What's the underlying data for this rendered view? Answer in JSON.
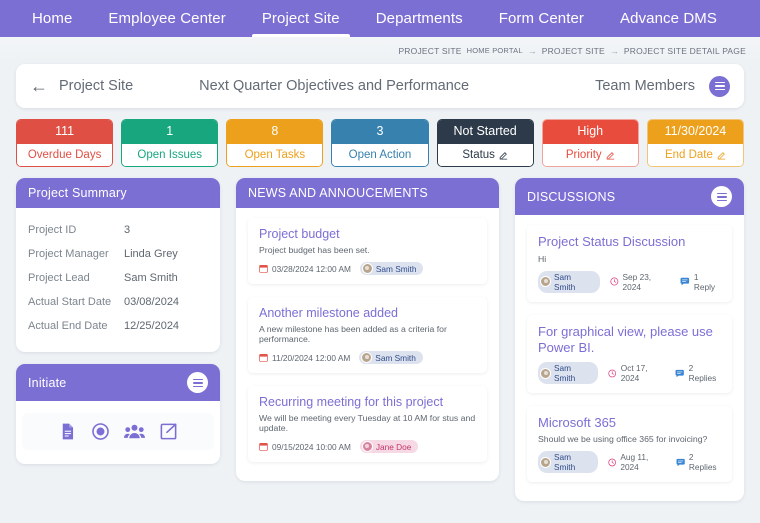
{
  "nav": {
    "items": [
      {
        "label": "Home",
        "active": false
      },
      {
        "label": "Employee Center",
        "active": false
      },
      {
        "label": "Project Site",
        "active": true
      },
      {
        "label": "Departments",
        "active": false
      },
      {
        "label": "Form Center",
        "active": false
      },
      {
        "label": "Advance DMS",
        "active": false
      }
    ]
  },
  "breadcrumb": {
    "label": "PROJECT SITE",
    "items": [
      "HOME PORTAL",
      "PROJECT SITE",
      "PROJECT SITE DETAIL PAGE"
    ],
    "separator": "→"
  },
  "titlebar": {
    "back_icon": "arrow-left-icon",
    "back_label": "Project Site",
    "page_title": "Next Quarter Objectives and Performance",
    "team_members_label": "Team Members",
    "menu_icon": "hamburger-icon"
  },
  "kpis": [
    {
      "value": "111",
      "label": "Overdue Days",
      "color": "#e04f44",
      "editable": false
    },
    {
      "value": "1",
      "label": "Open Issues",
      "color": "#18a67f",
      "editable": false
    },
    {
      "value": "8",
      "label": "Open Tasks",
      "color": "#eda01b",
      "editable": false
    },
    {
      "value": "3",
      "label": "Open Action",
      "color": "#3681ad",
      "editable": false
    },
    {
      "value": "Not Started",
      "label": "Status",
      "color": "#2c3a49",
      "editable": true
    },
    {
      "value": "High",
      "label": "Priority",
      "color": "#e84c3d",
      "editable": true
    },
    {
      "value": "11/30/2024",
      "label": "End Date",
      "color": "#eda01b",
      "editable": true
    }
  ],
  "summary": {
    "title": "Project Summary",
    "rows": [
      {
        "key": "Project ID",
        "value": "3"
      },
      {
        "key": "Project Manager",
        "value": "Linda Grey"
      },
      {
        "key": "Project Lead",
        "value": "Sam Smith"
      },
      {
        "key": "Actual Start Date",
        "value": "03/08/2024"
      },
      {
        "key": "Actual End Date",
        "value": "12/25/2024"
      }
    ]
  },
  "initiate": {
    "title": "Initiate",
    "menu_icon": "hamburger-icon",
    "actions": [
      {
        "icon": "document-icon"
      },
      {
        "icon": "record-circle-icon"
      },
      {
        "icon": "users-group-icon"
      },
      {
        "icon": "share-icon"
      }
    ]
  },
  "news": {
    "title": "NEWS AND ANNOUCEMENTS",
    "items": [
      {
        "title": "Project budget",
        "desc": "Project budget has been set.",
        "date": "03/28/2024 12:00 AM",
        "author": "Sam Smith",
        "author_style": "blue"
      },
      {
        "title": "Another milestone added",
        "desc": "A new milestone has been added as a criteria for performance.",
        "date": "11/20/2024 12:00 AM",
        "author": "Sam Smith",
        "author_style": "blue"
      },
      {
        "title": "Recurring meeting for this project",
        "desc": "We will be meeting every Tuesday at 10 AM for stus and update.",
        "date": "09/15/2024 10:00 AM",
        "author": "Jane Doe",
        "author_style": "pink"
      }
    ]
  },
  "discussions": {
    "title": "DISCUSSIONS",
    "menu_icon": "hamburger-icon",
    "items": [
      {
        "title": "Project Status Discussion",
        "desc": "Hi",
        "author": "Sam Smith",
        "date": "Sep 23, 2024",
        "replies": "1 Reply"
      },
      {
        "title": "For graphical view, please use Power BI.",
        "desc": "",
        "author": "Sam Smith",
        "date": "Oct 17, 2024",
        "replies": "2 Replies"
      },
      {
        "title": "Microsoft 365",
        "desc": "Should we be using office 365 for invoicing?",
        "author": "Sam Smith",
        "date": "Aug 11, 2024",
        "replies": "2 Replies"
      }
    ]
  },
  "colors": {
    "brand_purple": "#7b6fd4",
    "page_bg": "#eef2f5",
    "link": "#7b6fd4"
  }
}
